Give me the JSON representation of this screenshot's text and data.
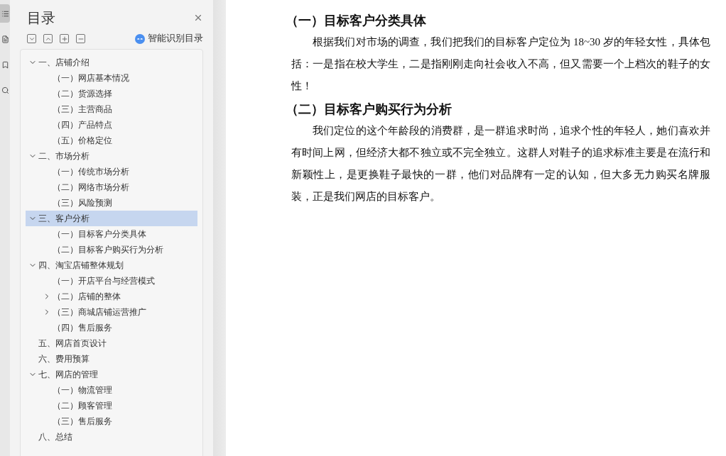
{
  "sidebar": {
    "title": "目录",
    "smart_button": "智能识别目录",
    "rail": [
      {
        "selected": true
      },
      {
        "selected": false
      },
      {
        "selected": false
      },
      {
        "selected": false
      }
    ],
    "toc": [
      {
        "label": "一、店铺介绍",
        "selected": false,
        "expanded": true,
        "children": [
          {
            "label": "（一）网店基本情况",
            "selected": false
          },
          {
            "label": "（二）货源选择",
            "selected": false
          },
          {
            "label": "（三）主营商品",
            "selected": false
          },
          {
            "label": "（四）产品特点",
            "selected": false
          },
          {
            "label": "（五）价格定位",
            "selected": false
          }
        ]
      },
      {
        "label": "二、市场分析",
        "selected": false,
        "expanded": true,
        "children": [
          {
            "label": "（一）传统市场分析",
            "selected": false
          },
          {
            "label": "（二）网络市场分析",
            "selected": false
          },
          {
            "label": "（三）风险预测",
            "selected": false
          }
        ]
      },
      {
        "label": "三、客户分析",
        "selected": true,
        "expanded": true,
        "children": [
          {
            "label": "（一）目标客户分类具体",
            "selected": false
          },
          {
            "label": "（二）目标客户购买行为分析",
            "selected": false
          }
        ]
      },
      {
        "label": "四、淘宝店铺整体规划",
        "selected": false,
        "expanded": true,
        "children": [
          {
            "label": "（一）开店平台与经营模式",
            "selected": false
          },
          {
            "label": "（二）店铺的整体",
            "selected": false,
            "expanded": false
          },
          {
            "label": "（三）商城店铺运营推广",
            "selected": false,
            "expanded": false
          },
          {
            "label": "（四）售后服务",
            "selected": false
          }
        ]
      },
      {
        "label": "五、网店首页设计",
        "selected": false
      },
      {
        "label": "六、费用预算",
        "selected": false
      },
      {
        "label": "七、网店的管理",
        "selected": false,
        "expanded": true,
        "children": [
          {
            "label": "（一）物流管理",
            "selected": false
          },
          {
            "label": "（二）顾客管理",
            "selected": false
          },
          {
            "label": "（三）售后服务",
            "selected": false
          }
        ]
      },
      {
        "label": "八、总结",
        "selected": false
      }
    ]
  },
  "document": [
    {
      "kind": "heading",
      "text": "（一）目标客户分类具体"
    },
    {
      "kind": "paragraph",
      "text": "根据我们对市场的调查，我们把我们的目标客户定位为 18~30 岁的年轻女性，具体包括：一是指在校大学生，二是指刚刚走向社会收入不高，但又需要一个上档次的鞋子的女性！"
    },
    {
      "kind": "heading",
      "text": "（二）目标客户购买行为分析"
    },
    {
      "kind": "paragraph",
      "text": "我们定位的这个年龄段的消费群，是一群追求时尚，追求个性的年轻人，她们喜欢并有时间上网，但经济大都不独立或不完全独立。这群人对鞋子的追求标准主要是在流行和新颖性上，是更换鞋子最快的一群，他们对品牌有一定的认知，但大多无力购买名牌服装，正是我们网店的目标客户。"
    }
  ]
}
